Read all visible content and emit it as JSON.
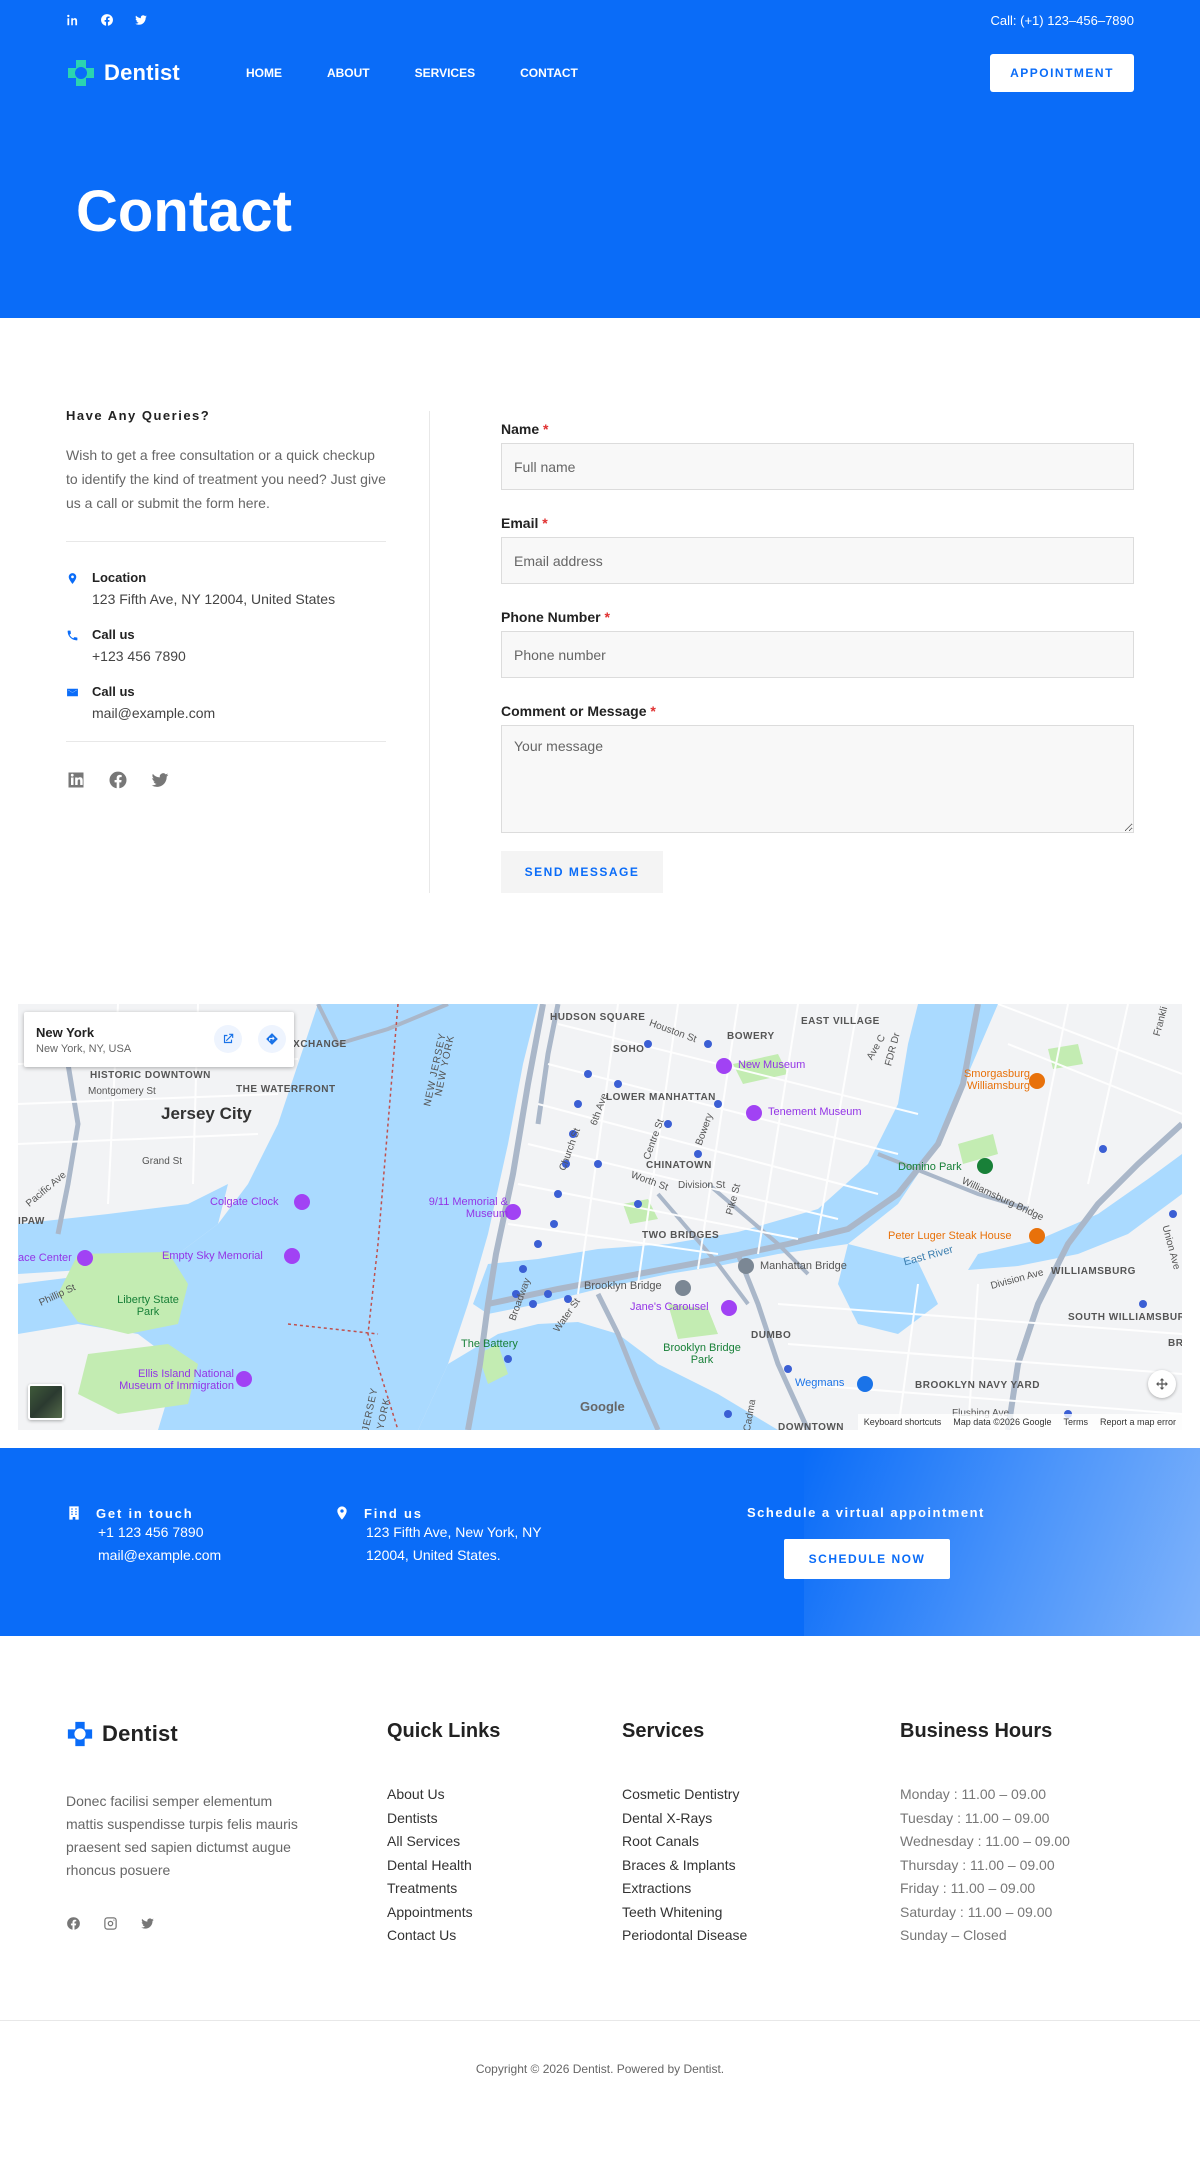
{
  "topbar": {
    "phone": "Call: (+1) 123–456–7890"
  },
  "brand": {
    "name": "Dentist"
  },
  "nav": {
    "items": [
      "HOME",
      "ABOUT",
      "SERVICES",
      "CONTACT"
    ],
    "cta": "APPOINTMENT"
  },
  "hero": {
    "title": "Contact"
  },
  "contact_info": {
    "title": "Have Any Queries?",
    "text": "Wish to get a free consultation or a quick checkup to identify the kind of treatment you need? Just give us a call or submit the form here.",
    "items": [
      {
        "label": "Location",
        "value": "123 Fifth Ave, NY 12004, United States",
        "icon": "location-pin-icon"
      },
      {
        "label": "Call us",
        "value": "+123 456 7890",
        "icon": "phone-icon"
      },
      {
        "label": "Call us",
        "value": "mail@example.com",
        "icon": "envelope-icon"
      }
    ]
  },
  "form": {
    "name": {
      "label": "Name",
      "placeholder": "Full name"
    },
    "email": {
      "label": "Email",
      "placeholder": "Email address"
    },
    "phone": {
      "label": "Phone Number",
      "placeholder": "Phone number"
    },
    "message": {
      "label": "Comment or Message",
      "placeholder": "Your message"
    },
    "required_mark": "*",
    "submit": "SEND MESSAGE"
  },
  "map": {
    "place_name": "New York",
    "place_address": "New York, NY, USA",
    "labels": {
      "jersey_city": "Jersey City",
      "historic_downtown": "HISTORIC DOWNTOWN",
      "exchange": "EXCHANGE",
      "the_waterfront": "THE WATERFRONT",
      "hudson_square": "HUDSON SQUARE",
      "soho": "SOHO",
      "bowery": "BOWERY",
      "east_village": "EAST VILLAGE",
      "lower_manhattan": "LOWER MANHATTAN",
      "chinatown": "CHINATOWN",
      "two_bridges": "TWO BRIDGES",
      "dumbo": "DUMBO",
      "williamsburg": "WILLIAMSBURG",
      "south_williamsburg": "SOUTH WILLIAMSBURG",
      "brooklyn_navy_yard": "BROOKLYN NAVY YARD",
      "paulus_hook": "IPAW",
      "new_museum": "New Museum",
      "tenement_museum": "Tenement Museum",
      "smorgasburg": "Smorgasburg Williamsburg",
      "domino_park": "Domino Park",
      "peter_luger": "Peter Luger Steak House",
      "colgate_clock": "Colgate Clock",
      "memorial": "9/11 Memorial & Museum",
      "empty_sky": "Empty Sky Memorial",
      "science_center": "ace Center",
      "liberty_park": "Liberty State Park",
      "ellis_island": "Ellis Island National Museum of Immigration",
      "brooklyn_bridge": "Brooklyn Bridge",
      "manhattan_bridge": "Manhattan Bridge",
      "janes_carousel": "Jane's Carousel",
      "the_battery": "The Battery",
      "brooklyn_bridge_park": "Brooklyn Bridge Park",
      "wegmans": "Wegmans",
      "williamsburg_bridge": "Williamsburg Bridge",
      "east_river": "East River",
      "flushing_ave": "Flushing Ave",
      "division_ave": "Division Ave",
      "grand_st": "Grand St",
      "montgomery_st": "Montgomery St",
      "pacific_ave": "Pacific Ave",
      "phillip_st": "Phillip St",
      "water_st": "Water St",
      "broadway": "Broadway",
      "church_st": "Church St",
      "centre_st": "Centre St",
      "bowery_st": "Bowery",
      "pike_st": "Pike St",
      "worth_st": "Worth St",
      "division_st": "Division St",
      "fdr_dr": "FDR Dr",
      "new_jersey": "NEW JERSEY",
      "new_york": "NEW YORK",
      "jersey_bottom": "JERSEY",
      "york_bottom": "YORK",
      "avenue_c": "Ave C",
      "houston_st": "Houston St",
      "frankli": "Frankli",
      "union_ave": "Union Ave",
      "downtown": "DOWNTOWN",
      "br": "BR",
      "sixth_ave": "6th Ave",
      "river_st": "River St",
      "cadma": "Cadma",
      "google": "Google"
    },
    "attribution": [
      "Keyboard shortcuts",
      "Map data ©2026 Google",
      "Terms",
      "Report a map error"
    ],
    "colors": {
      "water": "#aadaff",
      "land": "#f2f3f5",
      "park": "#c3ecb2",
      "road": "#ffffff",
      "highway": "#aab7c9"
    }
  },
  "cta": {
    "get_in_touch": {
      "title": "Get in touch",
      "lines": [
        "+1 123 456 7890",
        "mail@example.com"
      ]
    },
    "find_us": {
      "title": "Find us",
      "lines": [
        "123 Fifth Ave, New York, NY",
        "12004, United States."
      ]
    },
    "schedule": {
      "title": "Schedule a virtual appointment",
      "button": "SCHEDULE NOW"
    }
  },
  "footer": {
    "about": "Donec facilisi semper elementum mattis suspendisse turpis felis mauris praesent sed sapien dictumst augue rhoncus posuere",
    "quick_links": {
      "title": "Quick Links",
      "items": [
        "About Us",
        "Dentists",
        "All Services",
        "Dental Health",
        "Treatments",
        "Appointments",
        "Contact Us"
      ]
    },
    "services": {
      "title": "Services",
      "items": [
        "Cosmetic Dentistry",
        "Dental X-Rays",
        "Root Canals",
        "Braces & Implants",
        "Extractions",
        "Teeth Whitening",
        "Periodontal Disease"
      ]
    },
    "hours": {
      "title": "Business Hours",
      "items": [
        "Monday : 11.00 – 09.00",
        "Tuesday : 11.00 – 09.00",
        "Wednesday : 11.00 – 09.00",
        "Thursday : 11.00 – 09.00",
        "Friday : 11.00 – 09.00",
        "Saturday : 11.00 – 09.00",
        "Sunday – Closed"
      ]
    },
    "copyright": "Copyright © 2026 Dentist. Powered by Dentist."
  },
  "colors": {
    "brand": "#0a6cf8",
    "logo_accent": "#2bd4b0",
    "required": "#e03030"
  }
}
